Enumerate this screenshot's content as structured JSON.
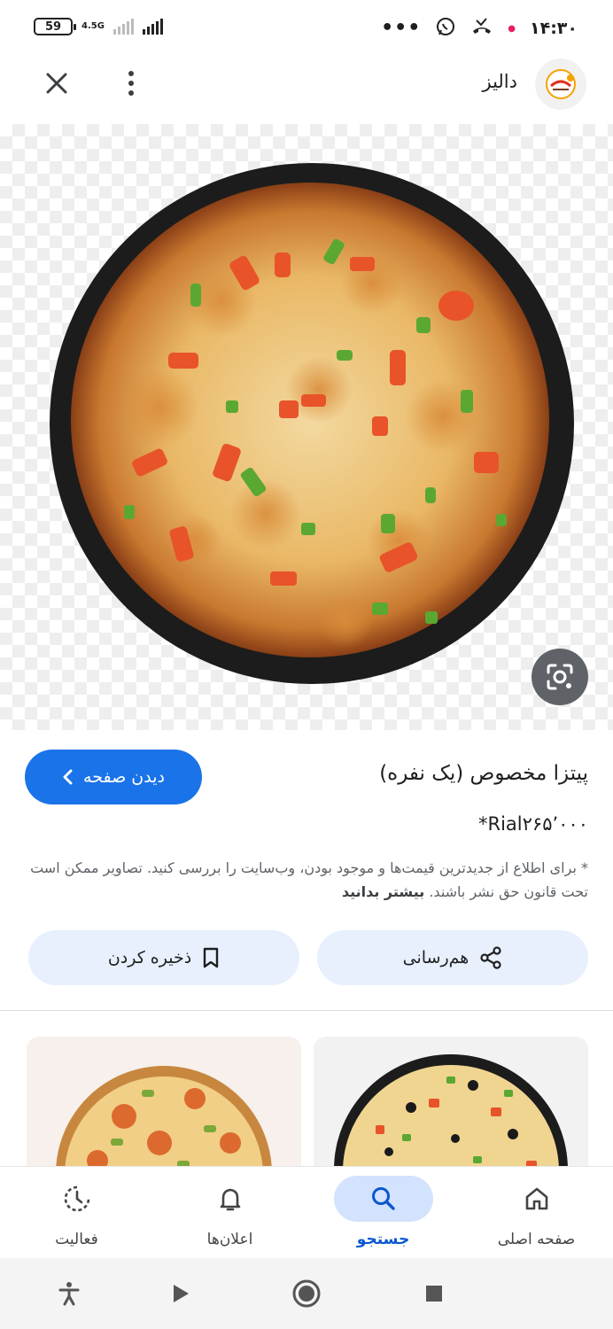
{
  "status_bar": {
    "battery": "59",
    "network": "4.5G",
    "time": "۱۴:۳۰",
    "more": "•••"
  },
  "header": {
    "site_name": "داليز",
    "logo_icon": "daliz-logo",
    "more_icon": "more-vert-icon",
    "close_icon": "close-icon"
  },
  "image": {
    "subject": "pizza",
    "lens_icon": "google-lens-icon"
  },
  "info": {
    "visit_button": "دیدن صفحه",
    "title": "پیتزا مخصوص (یک نفره)",
    "price": "*Rial۲۶۵٬۰۰۰",
    "disclaimer": "* برای اطلاع از جدیدترین قیمت‌ها و موجود بودن، وب‌سایت را بررسی کنید. تصاویر ممکن است تحت قانون حق نشر باشند.",
    "learn_more": "بیشتر بدانید"
  },
  "actions": {
    "share": "هم‌رسانی",
    "save": "ذخیره کردن"
  },
  "bottom_nav": {
    "items": [
      {
        "label": "صفحه اصلی",
        "icon": "home-icon"
      },
      {
        "label": "جستجو",
        "icon": "search-icon",
        "active": true
      },
      {
        "label": "اعلان‌ها",
        "icon": "bell-icon"
      },
      {
        "label": "فعالیت",
        "icon": "activity-icon"
      }
    ]
  },
  "colors": {
    "accent": "#1a73e8",
    "chip_bg": "#e8f0fe",
    "active_nav_bg": "#d3e3fd"
  }
}
